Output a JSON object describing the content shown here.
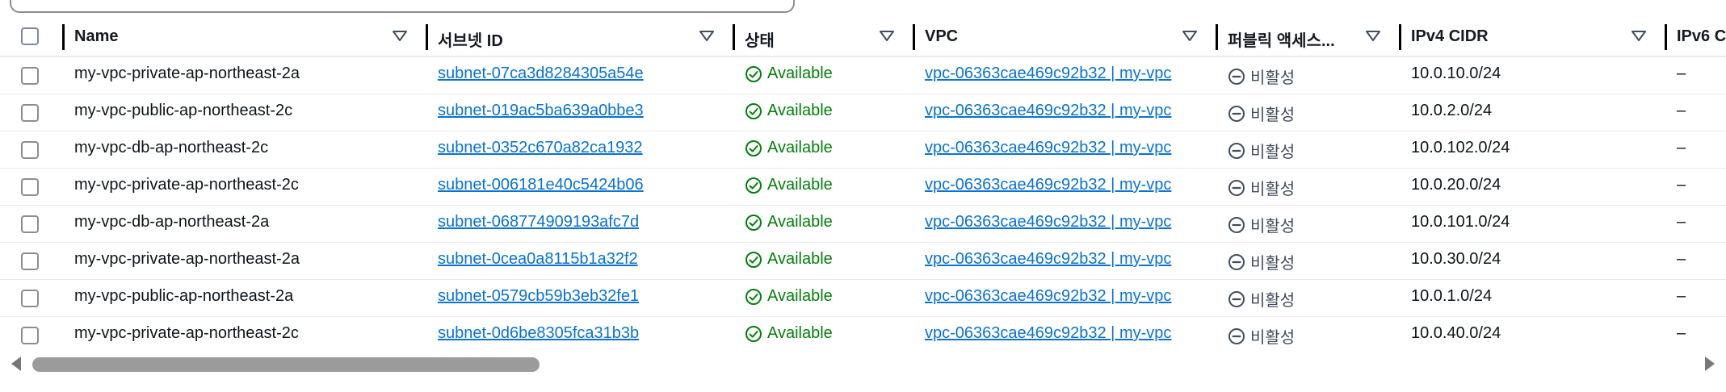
{
  "search": {
    "icon": "search-icon"
  },
  "columns": [
    {
      "key": "name",
      "label": "Name"
    },
    {
      "key": "subnet_id",
      "label": "서브넷 ID"
    },
    {
      "key": "state",
      "label": "상태"
    },
    {
      "key": "vpc",
      "label": "VPC"
    },
    {
      "key": "public_access",
      "label": "퍼블릭 액세스..."
    },
    {
      "key": "ipv4",
      "label": "IPv4 CIDR"
    },
    {
      "key": "ipv6",
      "label": "IPv6 C"
    }
  ],
  "rows": [
    {
      "name": "my-vpc-private-ap-northeast-2a",
      "subnet_id": "subnet-07ca3d8284305a54e",
      "state": "Available",
      "vpc": "vpc-06363cae469c92b32 | my-vpc",
      "public_access": "비활성",
      "ipv4": "10.0.10.0/24",
      "ipv6": "–"
    },
    {
      "name": "my-vpc-public-ap-northeast-2c",
      "subnet_id": "subnet-019ac5ba639a0bbe3",
      "state": "Available",
      "vpc": "vpc-06363cae469c92b32 | my-vpc",
      "public_access": "비활성",
      "ipv4": "10.0.2.0/24",
      "ipv6": "–"
    },
    {
      "name": "my-vpc-db-ap-northeast-2c",
      "subnet_id": "subnet-0352c670a82ca1932",
      "state": "Available",
      "vpc": "vpc-06363cae469c92b32 | my-vpc",
      "public_access": "비활성",
      "ipv4": "10.0.102.0/24",
      "ipv6": "–"
    },
    {
      "name": "my-vpc-private-ap-northeast-2c",
      "subnet_id": "subnet-006181e40c5424b06",
      "state": "Available",
      "vpc": "vpc-06363cae469c92b32 | my-vpc",
      "public_access": "비활성",
      "ipv4": "10.0.20.0/24",
      "ipv6": "–"
    },
    {
      "name": "my-vpc-db-ap-northeast-2a",
      "subnet_id": "subnet-068774909193afc7d",
      "state": "Available",
      "vpc": "vpc-06363cae469c92b32 | my-vpc",
      "public_access": "비활성",
      "ipv4": "10.0.101.0/24",
      "ipv6": "–"
    },
    {
      "name": "my-vpc-private-ap-northeast-2a",
      "subnet_id": "subnet-0cea0a8115b1a32f2",
      "state": "Available",
      "vpc": "vpc-06363cae469c92b32 | my-vpc",
      "public_access": "비활성",
      "ipv4": "10.0.30.0/24",
      "ipv6": "–"
    },
    {
      "name": "my-vpc-public-ap-northeast-2a",
      "subnet_id": "subnet-0579cb59b3eb32fe1",
      "state": "Available",
      "vpc": "vpc-06363cae469c92b32 | my-vpc",
      "public_access": "비활성",
      "ipv4": "10.0.1.0/24",
      "ipv6": "–"
    },
    {
      "name": "my-vpc-private-ap-northeast-2c",
      "subnet_id": "subnet-0d6be8305fca31b3b",
      "state": "Available",
      "vpc": "vpc-06363cae469c92b32 | my-vpc",
      "public_access": "비활성",
      "ipv4": "10.0.40.0/24",
      "ipv6": "–"
    }
  ],
  "colors": {
    "link": "#0972d3",
    "available": "#037f0c",
    "disabled": "#414d5c"
  },
  "icons": {
    "status_available": "check-circle-icon",
    "status_disabled": "minus-circle-icon",
    "sort": "caret-down-icon"
  }
}
